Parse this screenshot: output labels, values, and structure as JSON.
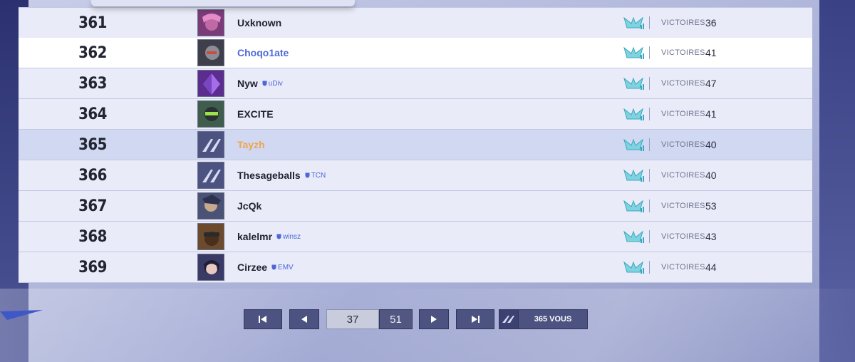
{
  "leaderboard": {
    "victories_label": "VICTOIRES",
    "rows": [
      {
        "rank": "361",
        "name": "Uxknown",
        "clan": "",
        "victories": "36",
        "style": "normal",
        "avatar": "pink-hair-character"
      },
      {
        "rank": "362",
        "name": "Choqo1ate",
        "clan": "",
        "victories": "41",
        "style": "white",
        "avatar": "robot-character"
      },
      {
        "rank": "363",
        "name": "Nyw",
        "clan": "uDiv",
        "victories": "47",
        "style": "normal",
        "avatar": "purple-crystal"
      },
      {
        "rank": "364",
        "name": "EXCITE",
        "clan": "",
        "victories": "41",
        "style": "normal",
        "avatar": "green-mask-character"
      },
      {
        "rank": "365",
        "name": "Tayzh",
        "clan": "",
        "victories": "40",
        "style": "you",
        "avatar": "default-logo"
      },
      {
        "rank": "366",
        "name": "Thesageballs",
        "clan": "TCN",
        "victories": "40",
        "style": "normal",
        "avatar": "default-logo"
      },
      {
        "rank": "367",
        "name": "JcQk",
        "clan": "",
        "victories": "53",
        "style": "normal",
        "avatar": "armored-character"
      },
      {
        "rank": "368",
        "name": "kalelmr",
        "clan": "winsz",
        "victories": "43",
        "style": "normal",
        "avatar": "goggles-character"
      },
      {
        "rank": "369",
        "name": "Cirzee",
        "clan": "EMV",
        "victories": "44",
        "style": "normal",
        "avatar": "dark-hair-character"
      }
    ]
  },
  "pagination": {
    "current_page": "37",
    "total_pages": "51",
    "you_label": "365 VOUS"
  },
  "colors": {
    "row_bg": "#e9ebf8",
    "row_white": "#ffffff",
    "row_you": "#d0d8f2",
    "name_blue": "#4f6bd8",
    "name_orange": "#f0a54b",
    "button_bg": "#4c5381"
  }
}
